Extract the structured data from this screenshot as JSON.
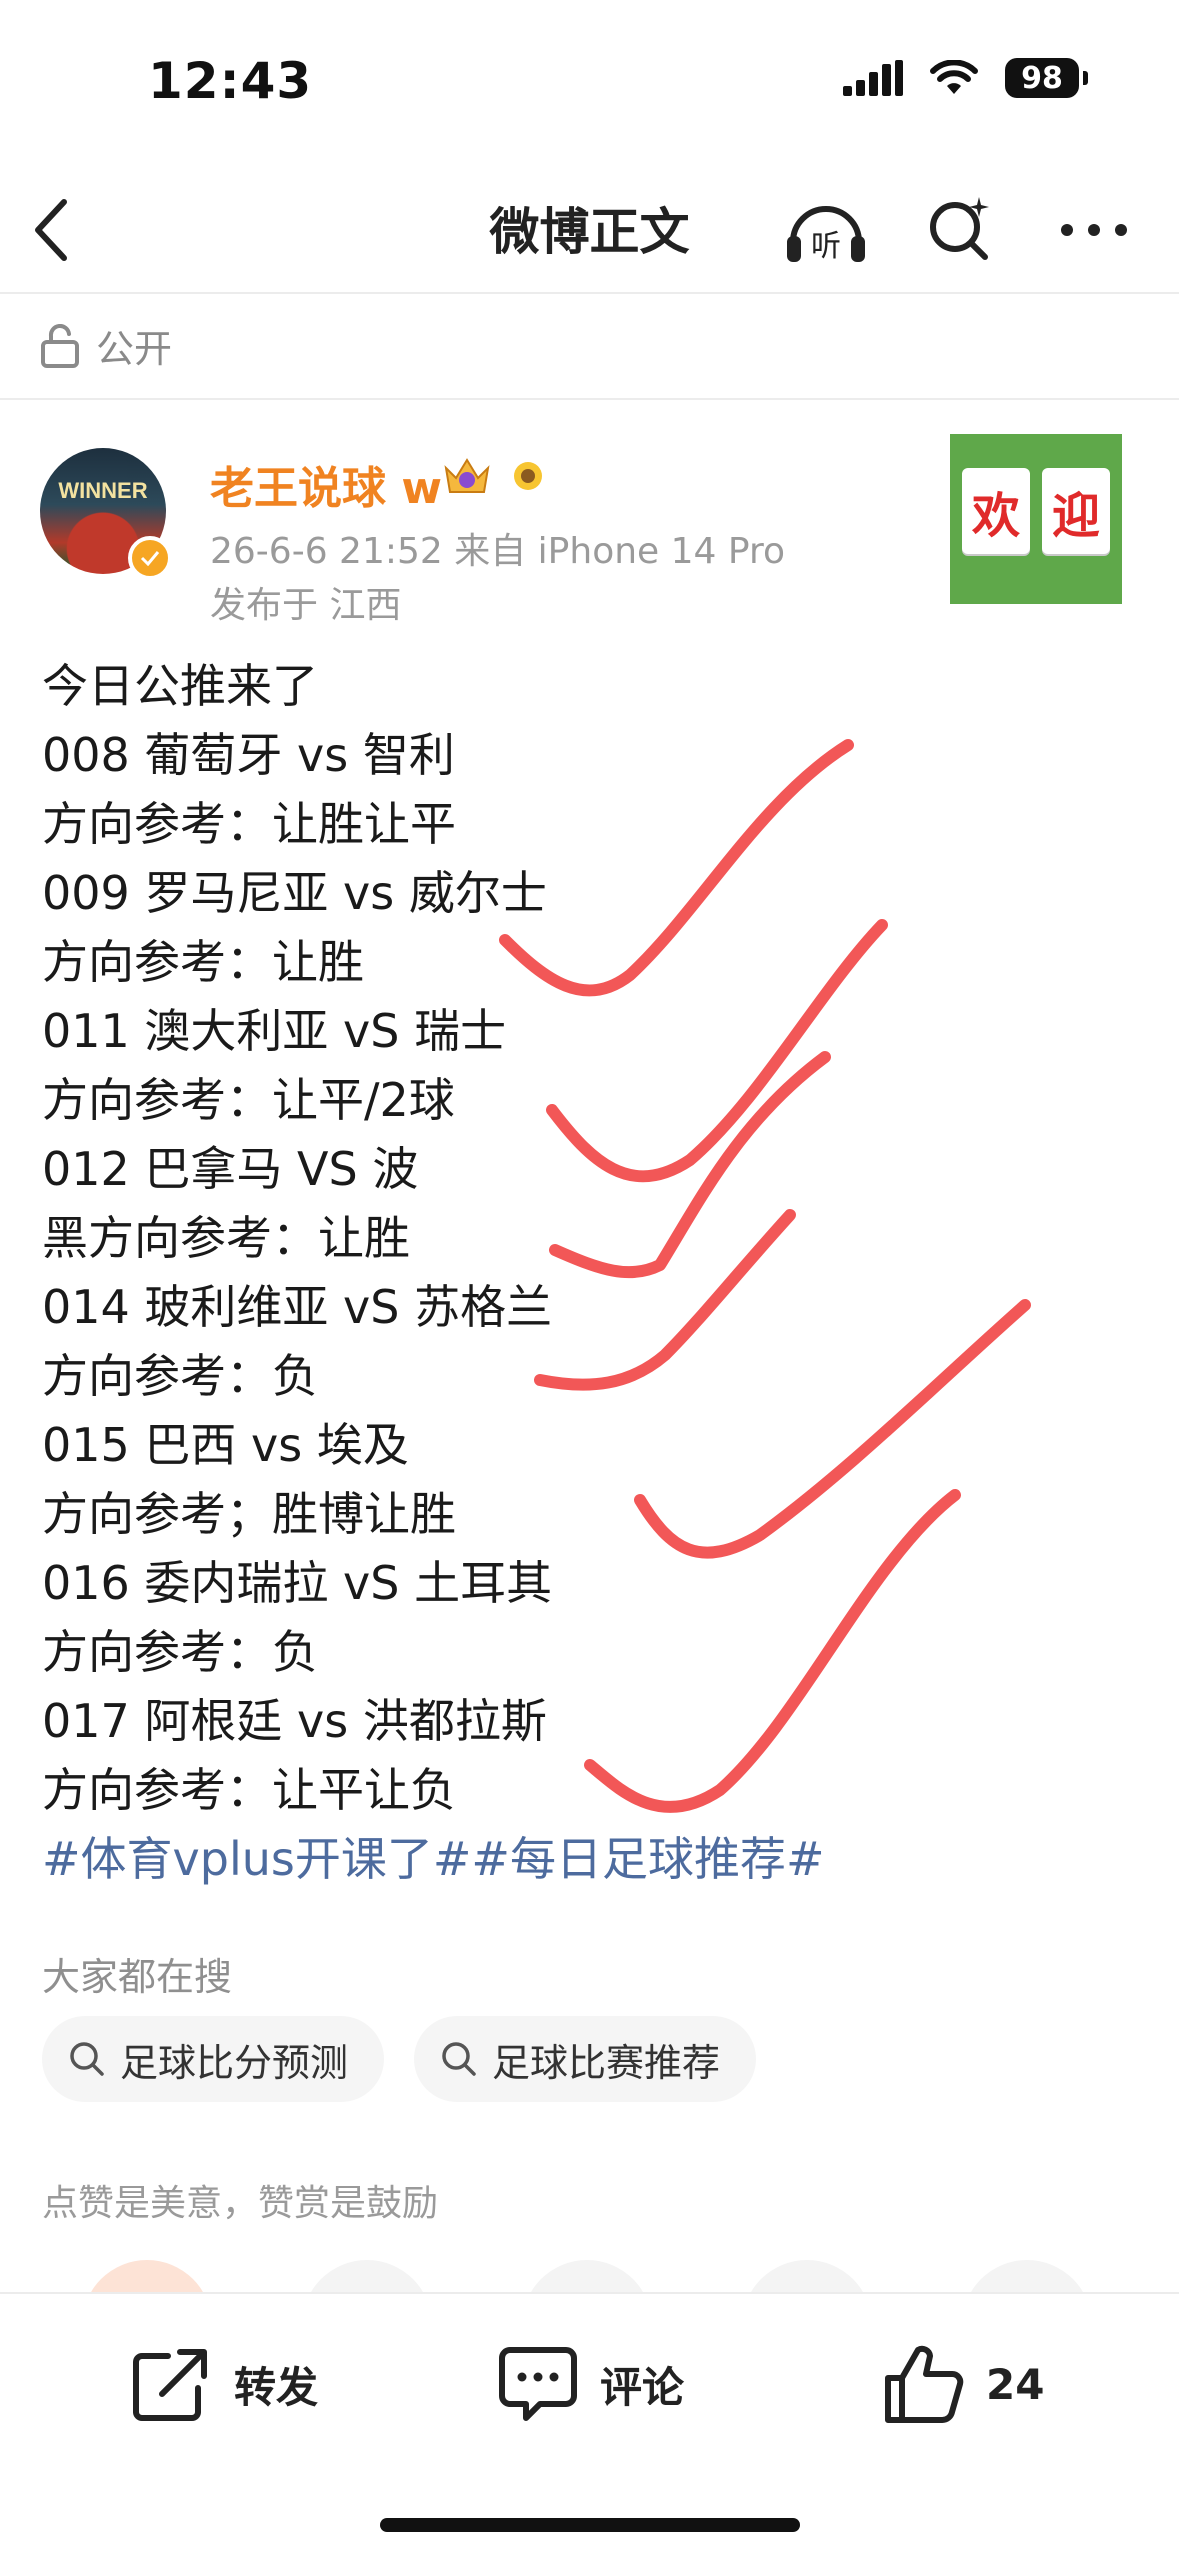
{
  "status_bar": {
    "time": "12:43",
    "battery": "98"
  },
  "nav": {
    "title": "微博正文"
  },
  "visibility": {
    "label": "公开"
  },
  "author": {
    "name": "老王说球 w",
    "avatar_text": "WINNER",
    "meta": "26-6-6 21:52  来自 iPhone 14 Pro",
    "location": "发布于 江西"
  },
  "welcome_card": {
    "char1": "欢",
    "char2": "迎"
  },
  "post": {
    "lines": [
      "今日公推来了",
      "008 葡萄牙 vs 智利",
      "方向参考：让胜让平",
      "009 罗马尼亚 vs 威尔士",
      "方向参考：让胜",
      "011 澳大利亚 vS 瑞士",
      "方向参考：让平/2球",
      "012 巴拿马 VS 波",
      "黑方向参考：让胜",
      "014 玻利维亚 vS 苏格兰",
      "方向参考：负",
      "015 巴西 vs 埃及",
      "方向参考；胜博让胜",
      "016 委内瑞拉 vS 土耳其",
      "方向参考：负",
      "017 阿根廷 vs 洪都拉斯",
      "方向参考：让平让负"
    ],
    "hashtags": "#体育vplus开课了##每日足球推荐#"
  },
  "search": {
    "heading": "大家都在搜",
    "chips": [
      "足球比分预测",
      "足球比赛推荐"
    ]
  },
  "reward": {
    "text": "点赞是美意，赞赏是鼓励"
  },
  "actions": {
    "repost": "转发",
    "comment": "评论",
    "like_count": "24"
  },
  "colors": {
    "author_name": "#f08321",
    "hashtag": "#4d6b9e",
    "check_mark": "#f25757"
  }
}
